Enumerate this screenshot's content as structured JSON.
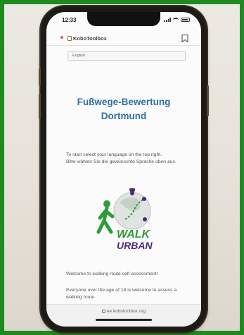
{
  "status_bar": {
    "time": "12:33"
  },
  "header": {
    "logo_text": "KoboToolbox"
  },
  "language_select": {
    "value": "English"
  },
  "form": {
    "title_line1": "Fußwege-Bewertung",
    "title_line2": "Dortmund",
    "intro_en": "To start select your language on the top right.",
    "intro_de": "Bitte wählen Sie die gewünschte Sprache oben aus.",
    "logo_word1": "WALK",
    "logo_word2": "URBAN",
    "welcome": "Welcome to walking route self-assessment!",
    "everyone": "Everyone over the age of 18 is welcome to assess a walking route."
  },
  "browser": {
    "url": "ee.kobotoolbox.org"
  },
  "colors": {
    "frame_green": "#1f8a1f",
    "title_blue": "#2e6fa7",
    "logo_green": "#2e9b3a",
    "logo_purple": "#4b2a7a"
  }
}
